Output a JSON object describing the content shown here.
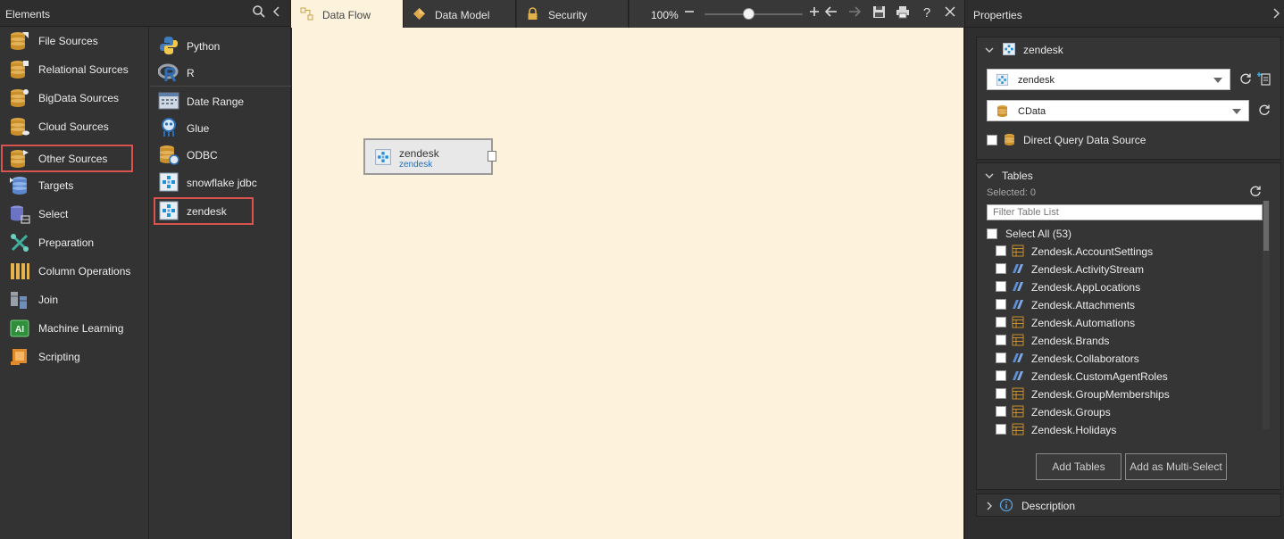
{
  "elements_panel": {
    "title": "Elements",
    "categories": [
      {
        "label": "File Sources",
        "icon": "file-sources-icon"
      },
      {
        "label": "Relational Sources",
        "icon": "relational-sources-icon"
      },
      {
        "label": "BigData Sources",
        "icon": "bigdata-sources-icon"
      },
      {
        "label": "Cloud Sources",
        "icon": "cloud-sources-icon"
      },
      {
        "label": "Other Sources",
        "icon": "other-sources-icon",
        "highlighted": true
      },
      {
        "label": "Targets",
        "icon": "targets-icon"
      },
      {
        "label": "Select",
        "icon": "select-icon"
      },
      {
        "label": "Preparation",
        "icon": "preparation-icon"
      },
      {
        "label": "Column Operations",
        "icon": "column-operations-icon"
      },
      {
        "label": "Join",
        "icon": "join-icon"
      },
      {
        "label": "Machine Learning",
        "icon": "machine-learning-icon",
        "icon_text": "AI"
      },
      {
        "label": "Scripting",
        "icon": "scripting-icon"
      }
    ],
    "sources": [
      {
        "label": "Python",
        "icon": "python-icon"
      },
      {
        "label": "R",
        "icon": "r-icon"
      },
      {
        "label": "Date Range",
        "icon": "date-range-icon"
      },
      {
        "label": "Glue",
        "icon": "glue-icon"
      },
      {
        "label": "ODBC",
        "icon": "odbc-icon"
      },
      {
        "label": "snowflake jdbc",
        "icon": "jdbc-icon"
      },
      {
        "label": "zendesk",
        "icon": "jdbc-icon",
        "highlighted": true
      }
    ]
  },
  "tabs": [
    {
      "label": "Data Flow",
      "icon": "data-flow-icon",
      "active": true
    },
    {
      "label": "Data Model",
      "icon": "data-model-icon",
      "active": false
    },
    {
      "label": "Security",
      "icon": "lock-icon",
      "active": false
    }
  ],
  "toolbar": {
    "zoom_label": "100%",
    "zoom_level_fraction": 0.45
  },
  "canvas": {
    "node": {
      "title": "zendesk",
      "subtitle": "zendesk",
      "icon": "jdbc-icon"
    }
  },
  "properties": {
    "title": "Properties",
    "source_section": {
      "title": "zendesk",
      "connection_value": "zendesk",
      "provider_value": "CData",
      "direct_query_label": "Direct Query Data Source",
      "direct_query_checked": false
    },
    "tables_section": {
      "title": "Tables",
      "selected_text": "Selected: 0",
      "filter_placeholder": "Filter Table List",
      "select_all_label": "Select All (53)",
      "tables": [
        {
          "name": "Zendesk.AccountSettings",
          "kind": "table"
        },
        {
          "name": "Zendesk.ActivityStream",
          "kind": "view"
        },
        {
          "name": "Zendesk.AppLocations",
          "kind": "view"
        },
        {
          "name": "Zendesk.Attachments",
          "kind": "view"
        },
        {
          "name": "Zendesk.Automations",
          "kind": "table"
        },
        {
          "name": "Zendesk.Brands",
          "kind": "table"
        },
        {
          "name": "Zendesk.Collaborators",
          "kind": "view"
        },
        {
          "name": "Zendesk.CustomAgentRoles",
          "kind": "view"
        },
        {
          "name": "Zendesk.GroupMemberships",
          "kind": "table"
        },
        {
          "name": "Zendesk.Groups",
          "kind": "table"
        },
        {
          "name": "Zendesk.Holidays",
          "kind": "table"
        }
      ],
      "add_tables_label": "Add Tables",
      "add_multi_label": "Add as Multi-Select"
    },
    "description_section": {
      "title": "Description"
    }
  },
  "colors": {
    "canvas_bg": "#fdf3dc",
    "highlight": "#d9534f",
    "panel_bg": "#333333",
    "accent_blue": "#2a6fb8"
  }
}
